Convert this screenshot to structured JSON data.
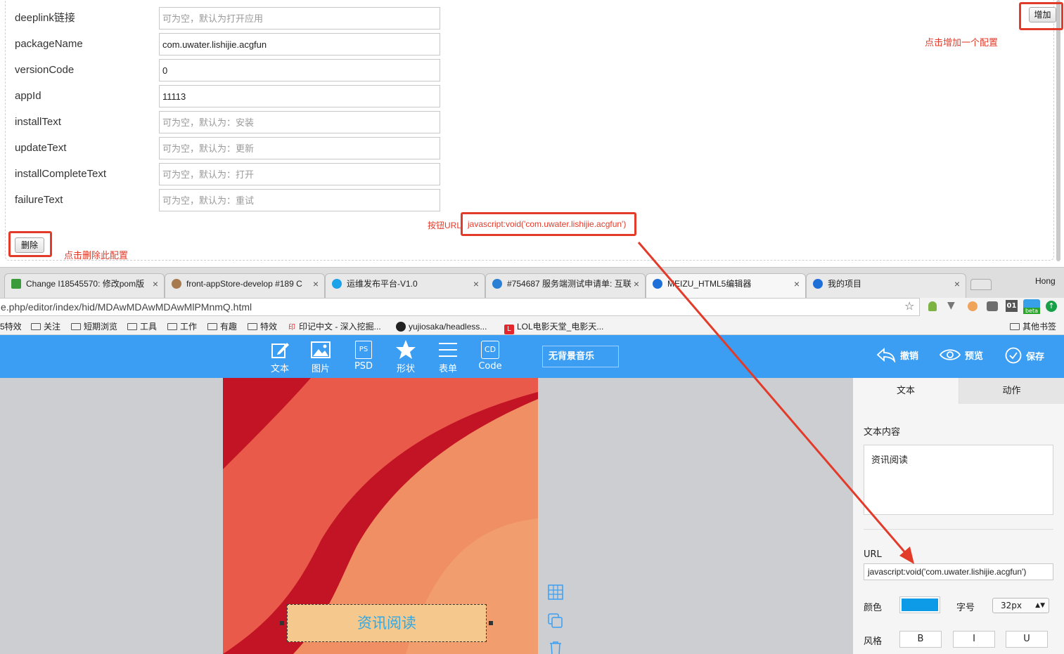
{
  "form": {
    "rows": [
      {
        "label": "deeplink链接",
        "value": "",
        "placeholder": "可为空，默认为打开应用"
      },
      {
        "label": "packageName",
        "value": "com.uwater.lishijie.acgfun",
        "placeholder": ""
      },
      {
        "label": "versionCode",
        "value": "0",
        "placeholder": ""
      },
      {
        "label": "appId",
        "value": "11113",
        "placeholder": ""
      },
      {
        "label": "installText",
        "value": "",
        "placeholder": "可为空，默认为：安装"
      },
      {
        "label": "updateText",
        "value": "",
        "placeholder": "可为空，默认为：更新"
      },
      {
        "label": "installCompleteText",
        "value": "",
        "placeholder": "可为空，默认为：打开"
      },
      {
        "label": "failureText",
        "value": "",
        "placeholder": "可为空，默认为：重试"
      }
    ],
    "add_button": "增加",
    "add_hint": "点击增加一个配置",
    "delete_button": "删除",
    "delete_hint": "点击删除此配置",
    "button_url_label": "按钮URL",
    "button_url_value": "javascript:void('com.uwater.lishijie.acgfun')"
  },
  "browser": {
    "tabs": [
      {
        "title": "Change I18545570: 修改pom版",
        "favicon_color": "#3a9b3a"
      },
      {
        "title": "front-appStore-develop #189 C",
        "favicon_color": "#a77b4e"
      },
      {
        "title": "运维发布平台-V1.0",
        "favicon_color": "#1aa3e8"
      },
      {
        "title": "#754687 服务端测试申请单: 互联",
        "favicon_color": "#2b7fd4"
      },
      {
        "title": "MEIZU_HTML5编辑器",
        "favicon_color": "#1f6fd8"
      },
      {
        "title": "我的项目",
        "favicon_color": "#1f6fd8"
      }
    ],
    "profile": "Hong",
    "url": "e.php/editor/index/hid/MDAwMDAwMDAwMlPMnmQ.html",
    "bookmarks": [
      "5特效",
      "关注",
      "短期浏览",
      "工具",
      "工作",
      "有趣",
      "特效",
      "印记中文 - 深入挖掘...",
      "yujiosaka/headless...",
      "LOL电影天堂_电影天..."
    ],
    "other_bookmarks": "其他书签",
    "beta_badge": "beta",
    "ext_01": "01"
  },
  "editor": {
    "tools": [
      {
        "label": "文本",
        "icon": "pencil-icon"
      },
      {
        "label": "图片",
        "icon": "image-icon"
      },
      {
        "label": "PSD",
        "icon": "psd-icon"
      },
      {
        "label": "形状",
        "icon": "star-icon"
      },
      {
        "label": "表单",
        "icon": "list-icon"
      },
      {
        "label": "Code",
        "icon": "code-icon"
      }
    ],
    "psd_glyph": "PS",
    "code_glyph": "CD",
    "music": "无背景音乐",
    "undo": "撤销",
    "preview": "预览",
    "save": "保存",
    "canvas_text": "资讯阅读",
    "panel": {
      "tab_text": "文本",
      "tab_action": "动作",
      "content_label": "文本内容",
      "content_value": "资讯阅读",
      "url_label": "URL",
      "url_value": "javascript:void('com.uwater.lishijie.acgfun')",
      "color_label": "颜色",
      "color_value": "#0d9be8",
      "size_label": "字号",
      "size_value": "32px",
      "style_label": "风格",
      "style_bold": "B",
      "style_italic": "I",
      "style_underline": "U"
    }
  },
  "colors": {
    "toolbar": "#3b9ef2",
    "annotation": "#e23b2a",
    "canvas_text": "#35a8e0"
  }
}
